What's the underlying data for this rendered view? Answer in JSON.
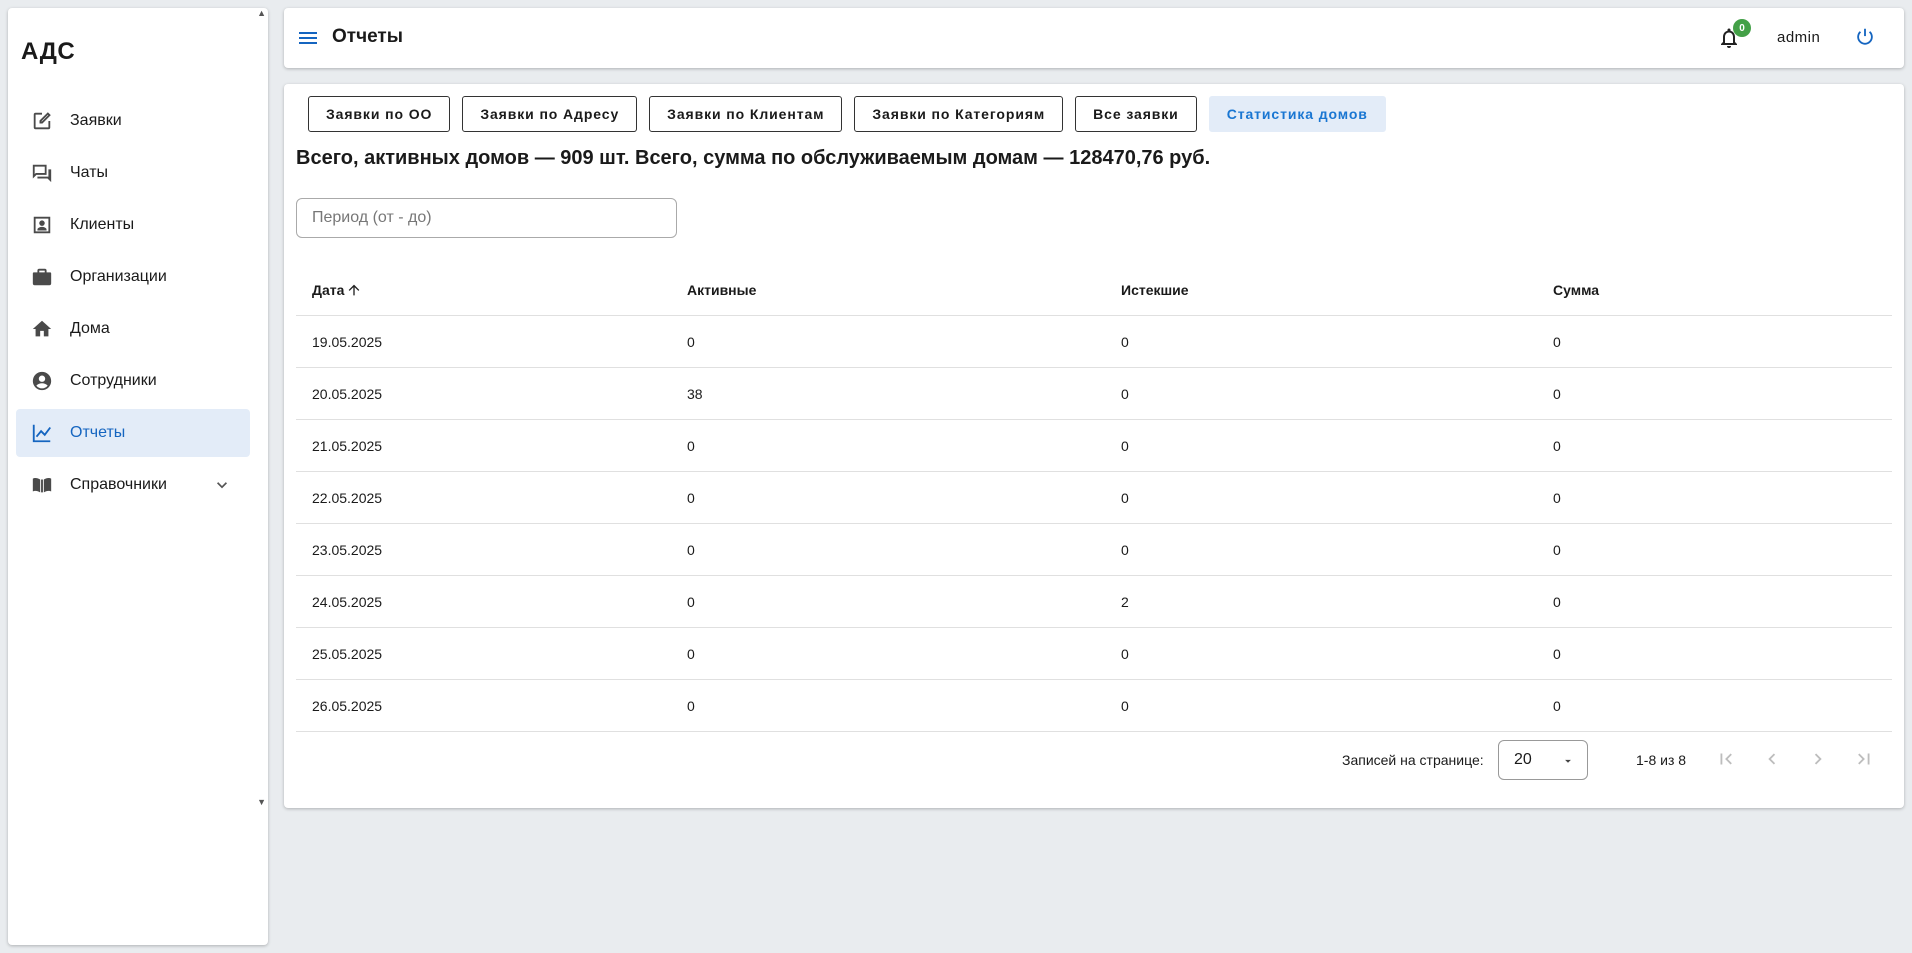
{
  "app": {
    "logo": "АДС"
  },
  "sidebar": {
    "items": [
      {
        "label": "Заявки",
        "icon": "edit-icon"
      },
      {
        "label": "Чаты",
        "icon": "chat-icon"
      },
      {
        "label": "Клиенты",
        "icon": "contact-card-icon"
      },
      {
        "label": "Организации",
        "icon": "briefcase-icon"
      },
      {
        "label": "Дома",
        "icon": "home-icon"
      },
      {
        "label": "Сотрудники",
        "icon": "account-circle-icon"
      },
      {
        "label": "Отчеты",
        "icon": "line-chart-icon",
        "active": true
      },
      {
        "label": "Справочники",
        "icon": "book-icon",
        "expandable": true
      }
    ]
  },
  "header": {
    "title": "Отчеты",
    "notifications_count": "0",
    "user": "admin"
  },
  "tabs": [
    {
      "label": "Заявки по ОО"
    },
    {
      "label": "Заявки по Адресу"
    },
    {
      "label": "Заявки по Клиентам"
    },
    {
      "label": "Заявки по Категориям"
    },
    {
      "label": "Все заявки"
    },
    {
      "label": "Статистика домов",
      "active": true
    }
  ],
  "summary": "Всего, активных домов — 909 шт. Всего, сумма по обслуживаемым домам — 128470,76 руб.",
  "filter": {
    "placeholder": "Период (от - до)",
    "value": ""
  },
  "table": {
    "columns": [
      "Дата",
      "Активные",
      "Истекшие",
      "Сумма"
    ],
    "rows": [
      [
        "19.05.2025",
        "0",
        "0",
        "0"
      ],
      [
        "20.05.2025",
        "38",
        "0",
        "0"
      ],
      [
        "21.05.2025",
        "0",
        "0",
        "0"
      ],
      [
        "22.05.2025",
        "0",
        "0",
        "0"
      ],
      [
        "23.05.2025",
        "0",
        "0",
        "0"
      ],
      [
        "24.05.2025",
        "0",
        "2",
        "0"
      ],
      [
        "25.05.2025",
        "0",
        "0",
        "0"
      ],
      [
        "26.05.2025",
        "0",
        "0",
        "0"
      ]
    ]
  },
  "pagination": {
    "rows_label": "Записей на странице:",
    "per_page": "20",
    "range": "1-8 из 8"
  },
  "colors": {
    "accent": "#1565c0",
    "active_bg": "#e3ecf8",
    "badge": "#43a047"
  }
}
